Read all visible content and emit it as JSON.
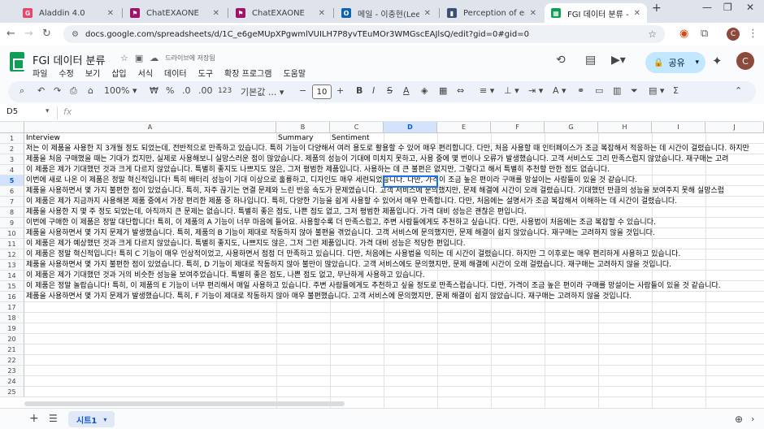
{
  "browser": {
    "tabs": [
      {
        "label": "Aladdin 4.0",
        "fav_color": "#e8456b",
        "fav_char": "G"
      },
      {
        "label": "ChatEXAONE",
        "fav_color": "#a1126b",
        "fav_char": "⚑"
      },
      {
        "label": "ChatEXAONE",
        "fav_color": "#a1126b",
        "fav_char": "⚑"
      },
      {
        "label": "메일 - 이충현(Lee Chu",
        "fav_color": "#0f62b3",
        "fav_char": "O"
      },
      {
        "label": "Perception of emotion",
        "fav_color": "#3b4f73",
        "fav_char": "▮"
      },
      {
        "label": "FGI 데이터 분류 - Goo",
        "fav_color": "#0f9d58",
        "fav_char": "▦"
      }
    ],
    "url": "docs.google.com/spreadsheets/d/1C_e6geMUpXPgwmlVUILH7P8yvTEuMOr3WMGscEAJlsQ/edit?gid=0#gid=0"
  },
  "doc": {
    "title": "FGI 데이터 분류",
    "saved_status": "드라이브에 저장됨",
    "menu": [
      "파일",
      "수정",
      "보기",
      "삽입",
      "서식",
      "데이터",
      "도구",
      "확장 프로그램",
      "도움말"
    ],
    "share_label": "공유",
    "avatar_letter": "C"
  },
  "toolbar": {
    "zoom": "100%",
    "currency": "₩",
    "percent": "%",
    "decimal_dec": ".0",
    "decimal_inc": ".00",
    "number_format": "123",
    "font": "기본값 ...",
    "font_size": "10",
    "bold": "B",
    "italic": "I",
    "strike": "S",
    "text_color": "A"
  },
  "formula_bar": {
    "cell_ref": "D5",
    "fx": "fx",
    "content": ""
  },
  "grid": {
    "columns": [
      "A",
      "B",
      "C",
      "D",
      "E",
      "F",
      "G",
      "H",
      "I",
      "J"
    ],
    "selected_col": "D",
    "selected_row": 5,
    "row_numbers": [
      "1",
      "2",
      "3",
      "4",
      "5",
      "6",
      "7",
      "8",
      "9",
      "10",
      "11",
      "12",
      "13",
      "14",
      "15",
      "16",
      "17",
      "18",
      "19",
      "20",
      "21",
      "22",
      "23",
      "24",
      "25"
    ],
    "header_row": {
      "interview": "Interview",
      "summary": "Summary",
      "sentiment": "Sentiment"
    },
    "interviews": [
      "저는 이 제품을 사용한 지 3개월 정도 되었는데, 전반적으로 만족하고 있습니다. 특히 기능이 다양해서 여러 용도로 활용할 수 있어 매우 편리합니다. 다만, 처음 사용할 때 인터페이스가 조금 복잡해서 적응하는 데 시간이 걸렸습니다. 하지만",
      "제품을 처음 구매했을 때는 기대가 컸지만, 실제로 사용해보니 실망스러운 점이 많았습니다. 제품의 성능이 기대에 미치지 못하고, 사용 중에 몇 번이나 오류가 발생했습니다. 고객 서비스도 그리 만족스럽지 않았습니다. 재구매는 고려",
      "이 제품은 제가 기대했던 것과 크게 다르지 않았습니다. 특별히 좋지도 나쁘지도 않은, 그저 평범한 제품입니다. 사용하는 데 큰 불편은 없지만, 그렇다고 해서 특별히 추천할 만한 점도 없습니다.",
      "이번에 새로 나온 이 제품은 정말 혁신적입니다! 특히 배터리 성능이 기대 이상으로 훌륭하고, 디자인도 매우 세련되었습니다. 다만, 가격이 조금 높은 편이라 구매를 망설이는 사람들이 있을 것 같습니다.",
      "제품을 사용하면서 몇 가지 불편한 점이 있었습니다. 특히, 자주 끊기는 연결 문제와 느린 반응 속도가 문제였습니다. 고객 서비스에 문의했지만, 문제 해결에 시간이 오래 걸렸습니다. 기대했던 만큼의 성능을 보여주지 못해 실망스럽",
      "이 제품은 제가 지금까지 사용해본 제품 중에서 가장 편리한 제품 중 하나입니다. 특히, 다양한 기능을 쉽게 사용할 수 있어서 매우 만족합니다. 다만, 처음에는 설명서가 조금 복잡해서 이해하는 데 시간이 걸렸습니다.",
      "제품을 사용한 지 몇 주 정도 되었는데, 아직까지 큰 문제는 없습니다. 특별히 좋은 점도, 나쁜 점도 없고, 그저 평범한 제품입니다. 가격 대비 성능은 괜찮은 편입니다.",
      "이번에 구매한 이 제품은 정말 대단합니다! 특히, 이 제품의 A 기능이 너무 마음에 들어요. 사용할수록 더 만족스럽고, 주변 사람들에게도 추천하고 싶습니다. 다만, 사용법이 처음에는 조금 복잡할 수 있습니다.",
      "제품을 사용하면서 몇 가지 문제가 발생했습니다. 특히, 제품의 B 기능이 제대로 작동하지 않아 불편을 겪었습니다. 고객 서비스에 문의했지만, 문제 해결이 쉽지 않았습니다. 재구매는 고려하지 않을 것입니다.",
      "이 제품은 제가 예상했던 것과 크게 다르지 않았습니다. 특별히 좋지도, 나쁘지도 않은, 그저 그런 제품입니다. 가격 대비 성능은 적당한 편입니다.",
      "이 제품은 정말 혁신적입니다! 특히 C 기능이 매우 인상적이었고, 사용하면서 점점 더 만족하고 있습니다. 다만, 처음에는 사용법을 익히는 데 시간이 걸렸습니다. 하지만 그 이후로는 매우 편리하게 사용하고 있습니다.",
      "제품을 사용하면서 몇 가지 불편한 점이 있었습니다. 특히, D 기능이 제대로 작동하지 않아 불만이 많았습니다. 고객 서비스에도 문의했지만, 문제 해결에 시간이 오래 걸렸습니다. 재구매는 고려하지 않을 것입니다.",
      "이 제품은 제가 기대했던 것과 거의 비슷한 성능을 보여주었습니다. 특별히 좋은 점도, 나쁜 점도 없고, 무난하게 사용하고 있습니다.",
      "이 제품은 정말 놀랍습니다! 특히, 이 제품의 E 기능이 너무 편리해서 매일 사용하고 있습니다. 주변 사람들에게도 추천하고 싶을 정도로 만족스럽습니다. 다만, 가격이 조금 높은 편이라 구매를 망설이는 사람들이 있을 것 같습니다.",
      "제품을 사용하면서 몇 가지 문제가 발생했습니다. 특히, F 기능이 제대로 작동하지 않아 매우 불편했습니다. 고객 서비스에 문의했지만, 문제 해결이 쉽지 않았습니다. 재구매는 고려하지 않을 것입니다."
    ]
  },
  "sheet_tab": {
    "label": "시트1"
  },
  "bottom": {
    "add": "+",
    "all_sheets": "☰"
  }
}
